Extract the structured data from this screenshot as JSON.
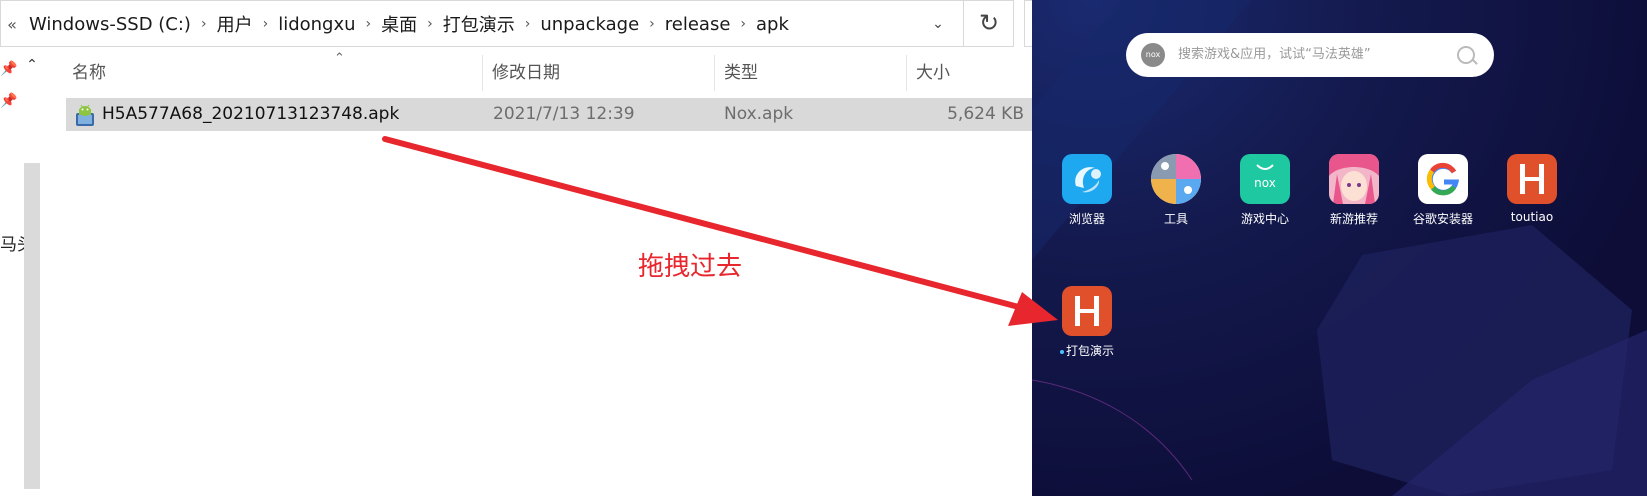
{
  "explorer": {
    "breadcrumb": [
      "Windows-SSD (C:)",
      "用户",
      "lidongxu",
      "桌面",
      "打包演示",
      "unpackage",
      "release",
      "apk"
    ],
    "nav_overflow": "«",
    "columns": {
      "name": "名称",
      "date": "修改日期",
      "type": "类型",
      "size": "大小"
    },
    "file": {
      "name": "H5A577A68_20210713123748.apk",
      "date": "2021/7/13 12:39",
      "type": "Nox.apk",
      "size": "5,624 KB"
    },
    "nav_partial_text": "马头",
    "icons": {
      "refresh": "refresh-icon",
      "search": "search-icon",
      "dropdown": "chevron-down-icon",
      "pin": "pin-icon"
    }
  },
  "annotation": {
    "text": "拖拽过去",
    "color": "#e8262d"
  },
  "emulator": {
    "search_placeholder": "搜索游戏&应用，试试“马法英雄”",
    "badge": "nox",
    "apps": [
      {
        "label": "浏览器",
        "icon": "browser-icon"
      },
      {
        "label": "工具",
        "icon": "tools-icon"
      },
      {
        "label": "游戏中心",
        "icon": "game-center-icon"
      },
      {
        "label": "新游推荐",
        "icon": "new-games-icon"
      },
      {
        "label": "谷歌安装器",
        "icon": "google-installer-icon"
      },
      {
        "label": "toutiao",
        "icon": "toutiao-icon"
      }
    ],
    "installed_app": {
      "label": "打包演示",
      "icon": "h-app-icon"
    },
    "nox_icon_text": "nox",
    "colors": {
      "background": "#0d0d38",
      "h_app": "#e0502a",
      "browser": "#1ea8f0",
      "game_center": "#1ec8a0"
    }
  }
}
